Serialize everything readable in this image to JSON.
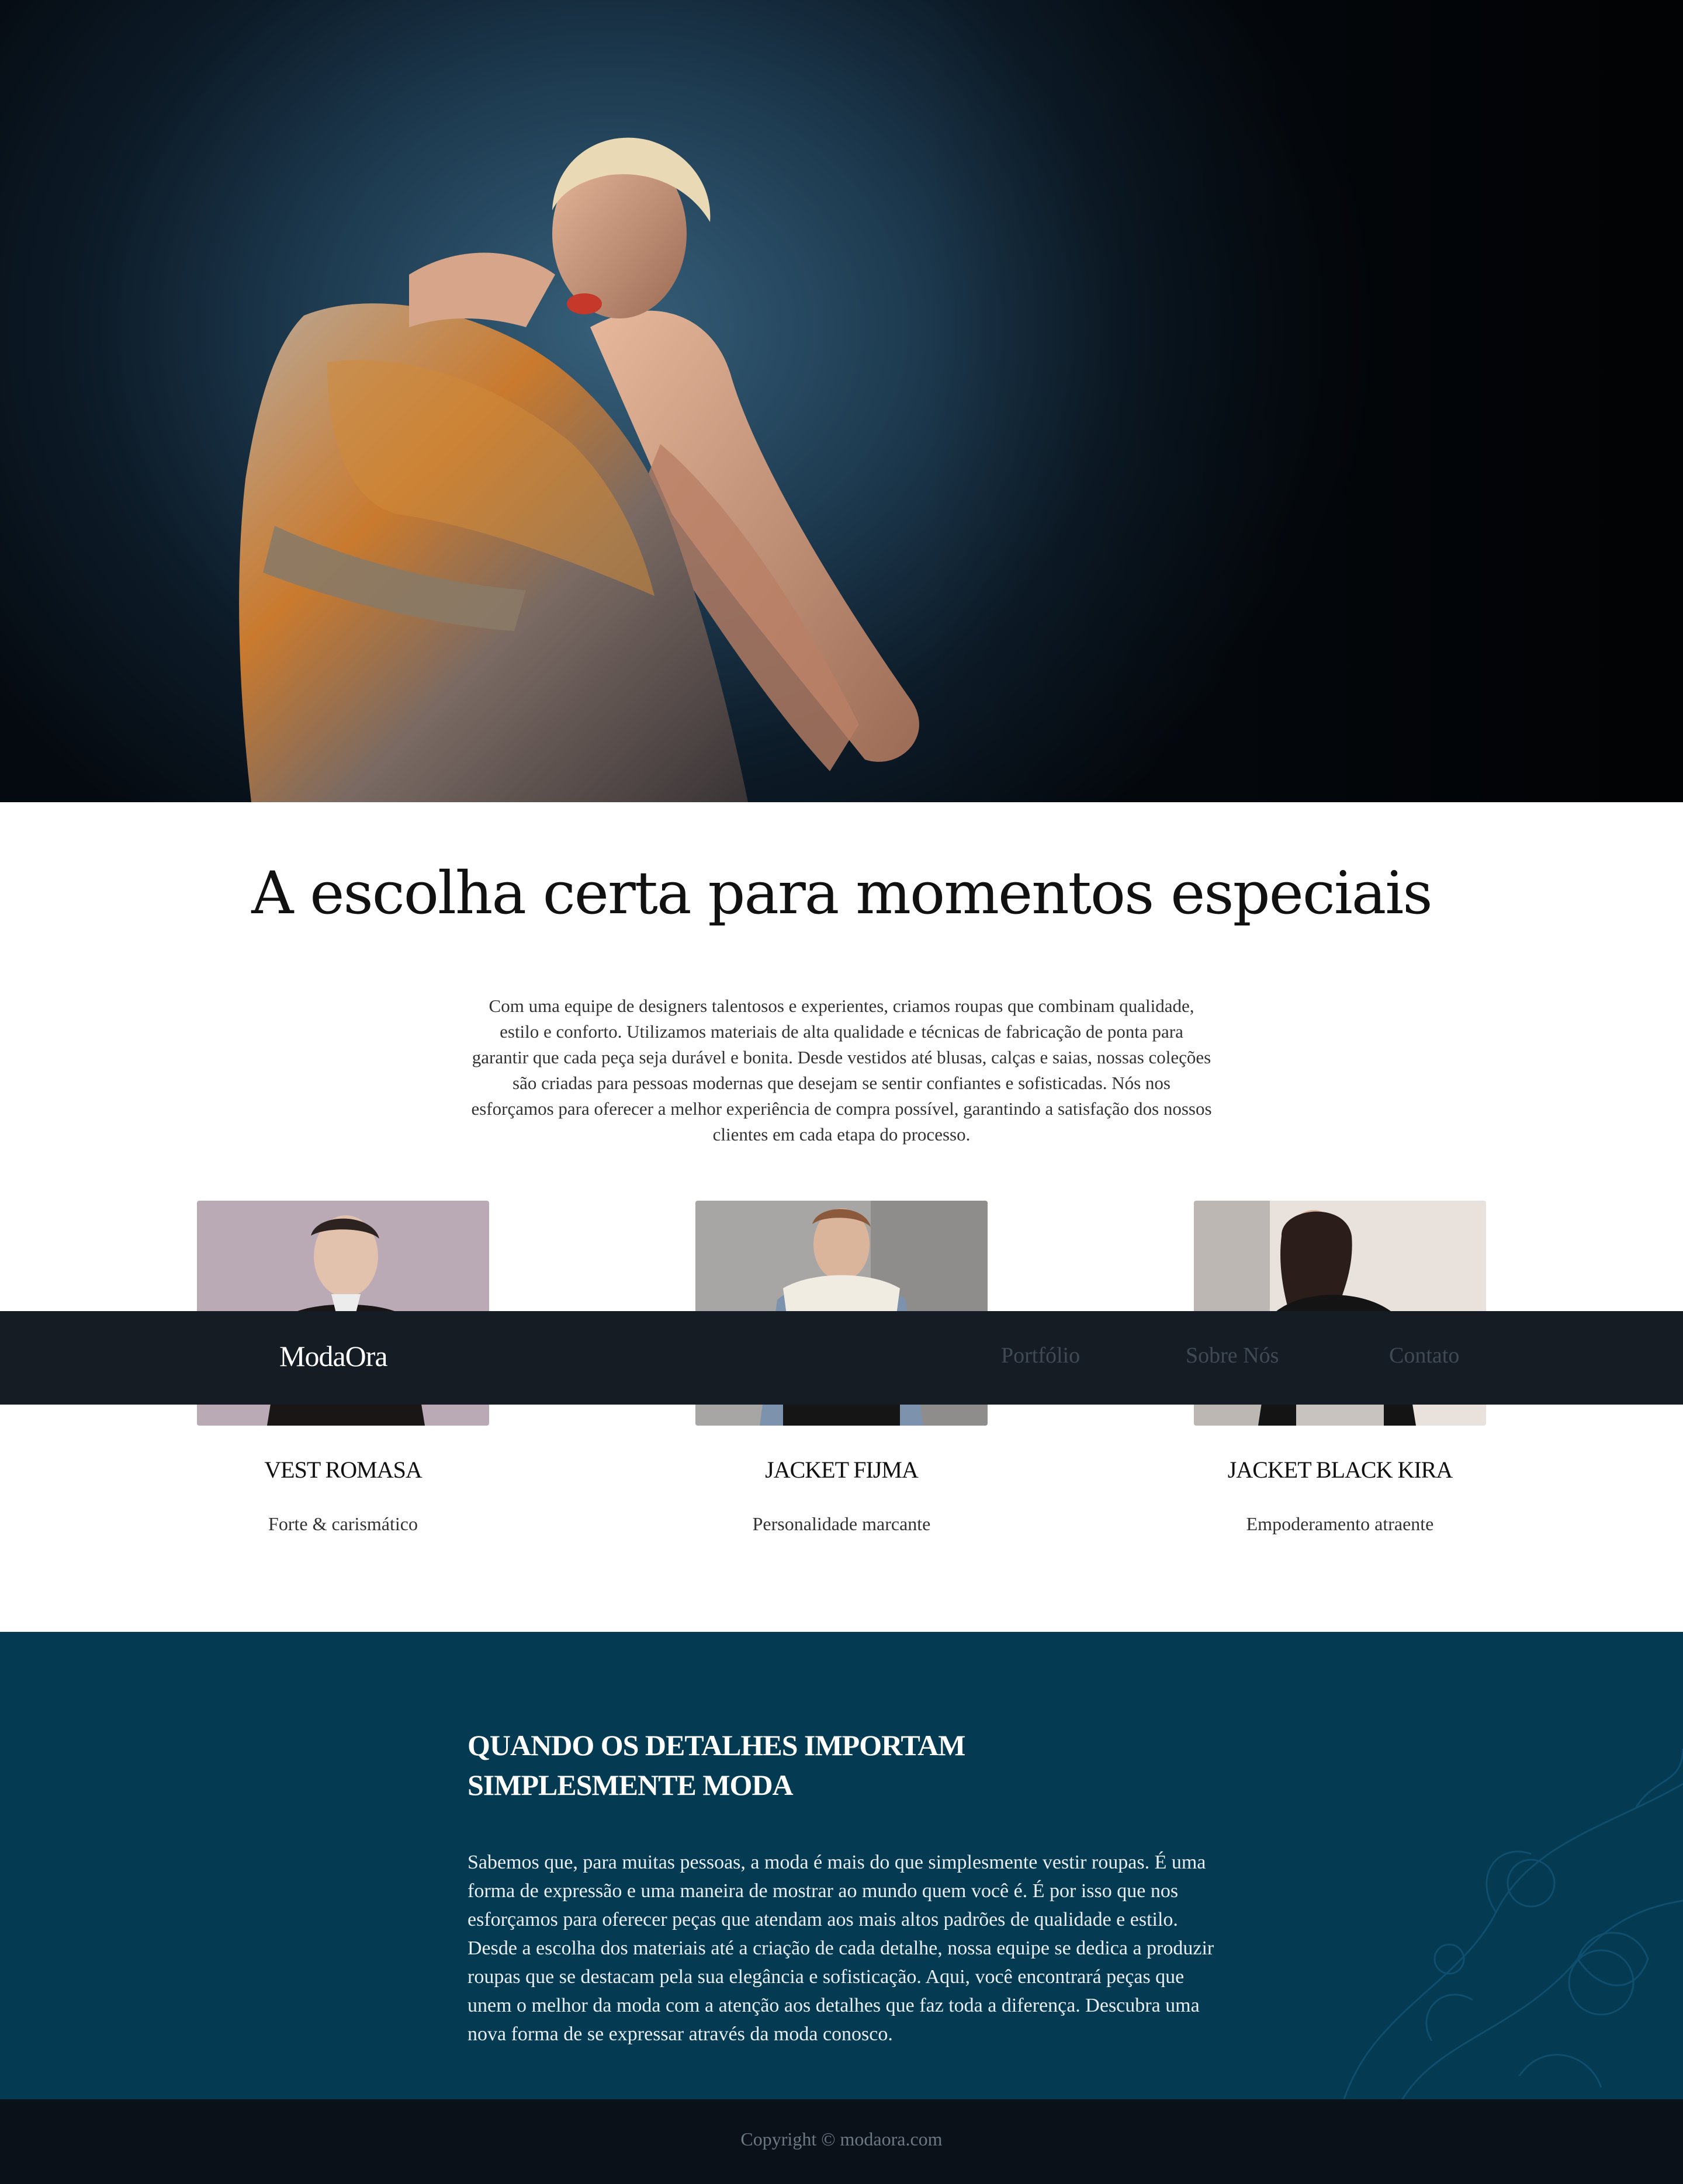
{
  "hero": {
    "image": "fashion-model-photo"
  },
  "intro": {
    "title": "A escolha certa para momentos especiais",
    "text": "Com uma equipe de designers talentosos e experientes, criamos roupas que combinam qualidade, estilo e conforto. Utilizamos materiais de alta qualidade e técnicas de fabricação de ponta para garantir que cada peça seja durável e bonita. Desde vestidos até blusas, calças e saias, nossas coleções são criadas para pessoas modernas que desejam se sentir confiantes e sofisticadas. Nós nos esforçamos para oferecer a melhor experiência de compra possível, garantindo a satisfação dos nossos clientes em cada etapa do processo."
  },
  "products": [
    {
      "name": "VEST ROMASA",
      "description": "Forte & carismático"
    },
    {
      "name": "JACKET FIJMA",
      "description": "Personalidade marcante"
    },
    {
      "name": "JACKET BLACK KIRA",
      "description": "Empoderamento atraente"
    }
  ],
  "navbar": {
    "brand": "ModaOra",
    "links": [
      "Portfólio",
      "Sobre Nós",
      "Contato"
    ]
  },
  "details": {
    "title_line1": "QUANDO OS DETALHES IMPORTAM",
    "title_line2": "SIMPLESMENTE MODA",
    "text": "Sabemos que, para muitas pessoas, a moda é mais do que simplesmente vestir roupas. É uma forma de expressão e uma maneira de mostrar ao mundo quem você é. É por isso que nos esforçamos para oferecer peças que atendam aos mais altos padrões de qualidade e estilo. Desde a escolha dos materiais até a criação de cada detalhe, nossa equipe se dedica a produzir roupas que se destacam pela sua elegância e sofisticação. Aqui, você encontrará peças que unem o melhor da moda com a atenção aos detalhes que faz toda a diferença. Descubra uma nova forma de se expressar através da moda conosco."
  },
  "footer": {
    "copyright": "Copyright © modaora.com"
  },
  "colors": {
    "navbar": "#151c24",
    "details_bg": "#043a52",
    "footer": "#0a1118"
  }
}
